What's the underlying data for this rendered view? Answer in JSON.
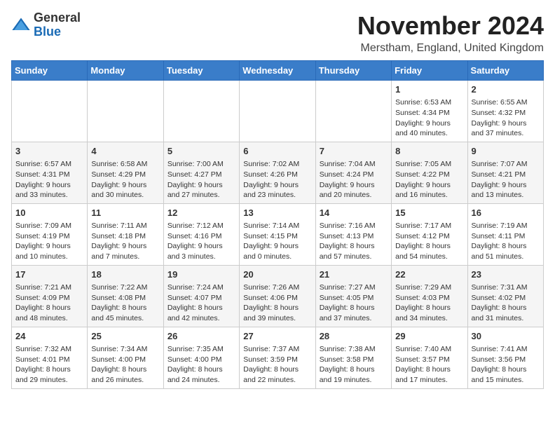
{
  "header": {
    "logo_general": "General",
    "logo_blue": "Blue",
    "month_title": "November 2024",
    "location": "Merstham, England, United Kingdom"
  },
  "days_of_week": [
    "Sunday",
    "Monday",
    "Tuesday",
    "Wednesday",
    "Thursday",
    "Friday",
    "Saturday"
  ],
  "weeks": [
    [
      {
        "day": "",
        "info": ""
      },
      {
        "day": "",
        "info": ""
      },
      {
        "day": "",
        "info": ""
      },
      {
        "day": "",
        "info": ""
      },
      {
        "day": "",
        "info": ""
      },
      {
        "day": "1",
        "info": "Sunrise: 6:53 AM\nSunset: 4:34 PM\nDaylight: 9 hours and 40 minutes."
      },
      {
        "day": "2",
        "info": "Sunrise: 6:55 AM\nSunset: 4:32 PM\nDaylight: 9 hours and 37 minutes."
      }
    ],
    [
      {
        "day": "3",
        "info": "Sunrise: 6:57 AM\nSunset: 4:31 PM\nDaylight: 9 hours and 33 minutes."
      },
      {
        "day": "4",
        "info": "Sunrise: 6:58 AM\nSunset: 4:29 PM\nDaylight: 9 hours and 30 minutes."
      },
      {
        "day": "5",
        "info": "Sunrise: 7:00 AM\nSunset: 4:27 PM\nDaylight: 9 hours and 27 minutes."
      },
      {
        "day": "6",
        "info": "Sunrise: 7:02 AM\nSunset: 4:26 PM\nDaylight: 9 hours and 23 minutes."
      },
      {
        "day": "7",
        "info": "Sunrise: 7:04 AM\nSunset: 4:24 PM\nDaylight: 9 hours and 20 minutes."
      },
      {
        "day": "8",
        "info": "Sunrise: 7:05 AM\nSunset: 4:22 PM\nDaylight: 9 hours and 16 minutes."
      },
      {
        "day": "9",
        "info": "Sunrise: 7:07 AM\nSunset: 4:21 PM\nDaylight: 9 hours and 13 minutes."
      }
    ],
    [
      {
        "day": "10",
        "info": "Sunrise: 7:09 AM\nSunset: 4:19 PM\nDaylight: 9 hours and 10 minutes."
      },
      {
        "day": "11",
        "info": "Sunrise: 7:11 AM\nSunset: 4:18 PM\nDaylight: 9 hours and 7 minutes."
      },
      {
        "day": "12",
        "info": "Sunrise: 7:12 AM\nSunset: 4:16 PM\nDaylight: 9 hours and 3 minutes."
      },
      {
        "day": "13",
        "info": "Sunrise: 7:14 AM\nSunset: 4:15 PM\nDaylight: 9 hours and 0 minutes."
      },
      {
        "day": "14",
        "info": "Sunrise: 7:16 AM\nSunset: 4:13 PM\nDaylight: 8 hours and 57 minutes."
      },
      {
        "day": "15",
        "info": "Sunrise: 7:17 AM\nSunset: 4:12 PM\nDaylight: 8 hours and 54 minutes."
      },
      {
        "day": "16",
        "info": "Sunrise: 7:19 AM\nSunset: 4:11 PM\nDaylight: 8 hours and 51 minutes."
      }
    ],
    [
      {
        "day": "17",
        "info": "Sunrise: 7:21 AM\nSunset: 4:09 PM\nDaylight: 8 hours and 48 minutes."
      },
      {
        "day": "18",
        "info": "Sunrise: 7:22 AM\nSunset: 4:08 PM\nDaylight: 8 hours and 45 minutes."
      },
      {
        "day": "19",
        "info": "Sunrise: 7:24 AM\nSunset: 4:07 PM\nDaylight: 8 hours and 42 minutes."
      },
      {
        "day": "20",
        "info": "Sunrise: 7:26 AM\nSunset: 4:06 PM\nDaylight: 8 hours and 39 minutes."
      },
      {
        "day": "21",
        "info": "Sunrise: 7:27 AM\nSunset: 4:05 PM\nDaylight: 8 hours and 37 minutes."
      },
      {
        "day": "22",
        "info": "Sunrise: 7:29 AM\nSunset: 4:03 PM\nDaylight: 8 hours and 34 minutes."
      },
      {
        "day": "23",
        "info": "Sunrise: 7:31 AM\nSunset: 4:02 PM\nDaylight: 8 hours and 31 minutes."
      }
    ],
    [
      {
        "day": "24",
        "info": "Sunrise: 7:32 AM\nSunset: 4:01 PM\nDaylight: 8 hours and 29 minutes."
      },
      {
        "day": "25",
        "info": "Sunrise: 7:34 AM\nSunset: 4:00 PM\nDaylight: 8 hours and 26 minutes."
      },
      {
        "day": "26",
        "info": "Sunrise: 7:35 AM\nSunset: 4:00 PM\nDaylight: 8 hours and 24 minutes."
      },
      {
        "day": "27",
        "info": "Sunrise: 7:37 AM\nSunset: 3:59 PM\nDaylight: 8 hours and 22 minutes."
      },
      {
        "day": "28",
        "info": "Sunrise: 7:38 AM\nSunset: 3:58 PM\nDaylight: 8 hours and 19 minutes."
      },
      {
        "day": "29",
        "info": "Sunrise: 7:40 AM\nSunset: 3:57 PM\nDaylight: 8 hours and 17 minutes."
      },
      {
        "day": "30",
        "info": "Sunrise: 7:41 AM\nSunset: 3:56 PM\nDaylight: 8 hours and 15 minutes."
      }
    ]
  ]
}
